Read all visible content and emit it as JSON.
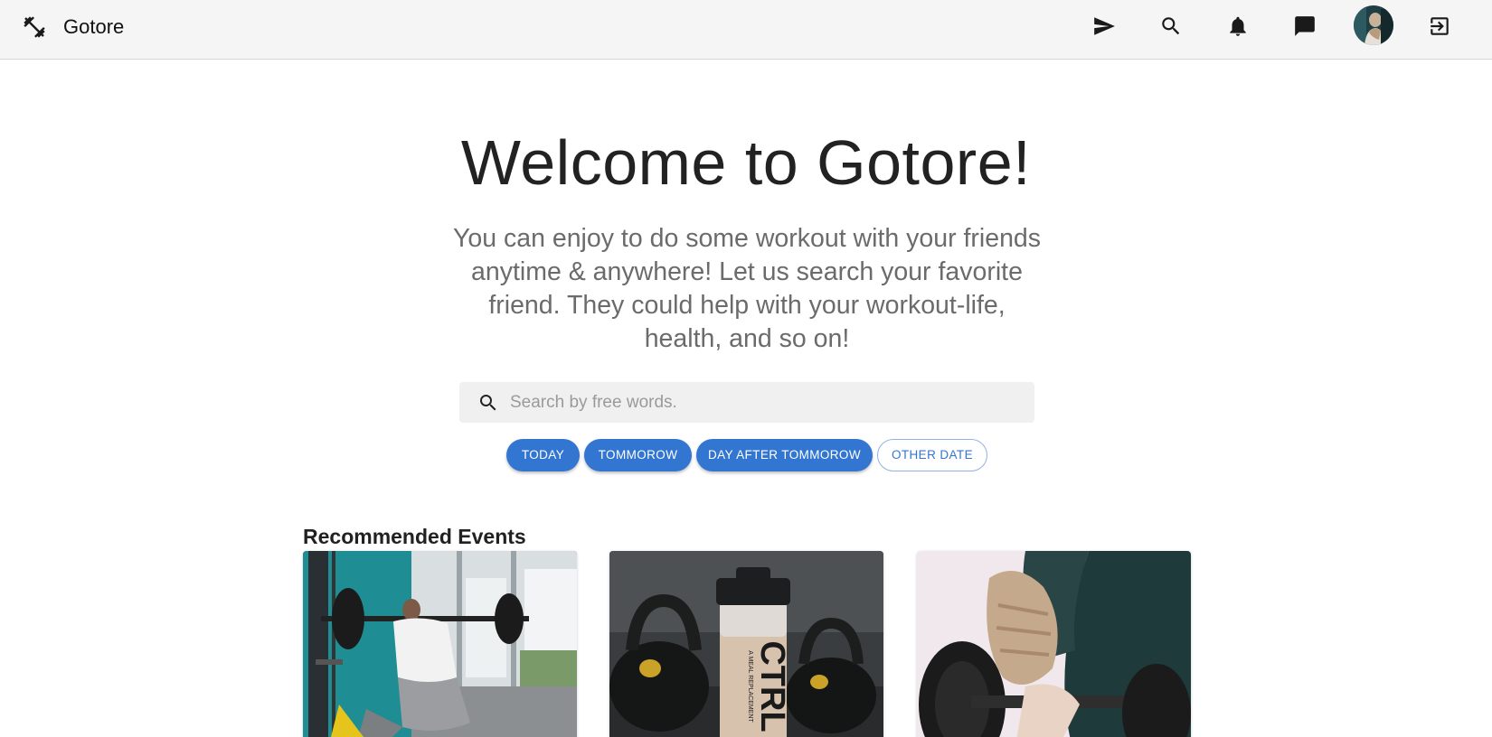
{
  "app": {
    "title": "Gotore"
  },
  "navbar": {
    "icons": [
      "fitness-icon",
      "send-icon",
      "search-icon",
      "notifications-icon",
      "chat-icon",
      "avatar",
      "logout-icon"
    ]
  },
  "hero": {
    "title": "Welcome to Gotore!",
    "subtitle": "You can enjoy to do some workout with your friends anytime & anywhere! Let us search your favorite friend. They could help with your workout-life, health, and so on!"
  },
  "search": {
    "placeholder": "Search by free words.",
    "value": ""
  },
  "date_filters": [
    {
      "label": "TODAY",
      "style": "filled"
    },
    {
      "label": "TOMMOROW",
      "style": "filled"
    },
    {
      "label": "DAY AFTER TOMMOROW",
      "style": "filled"
    },
    {
      "label": "OTHER DATE",
      "style": "outlined"
    }
  ],
  "recommended": {
    "title": "Recommended Events",
    "cards": [
      {
        "image": "barbell-squat-photo"
      },
      {
        "image": "kettlebells-ctrl-shaker-photo",
        "image_text": "CTRL",
        "image_subtext": "A MEAL REPLACEMENT"
      },
      {
        "image": "dumbbell-grip-photo"
      }
    ]
  },
  "colors": {
    "accent": "#3276d2",
    "appbar_bg": "#f5f5f5",
    "search_bg": "#f0f0f0"
  }
}
